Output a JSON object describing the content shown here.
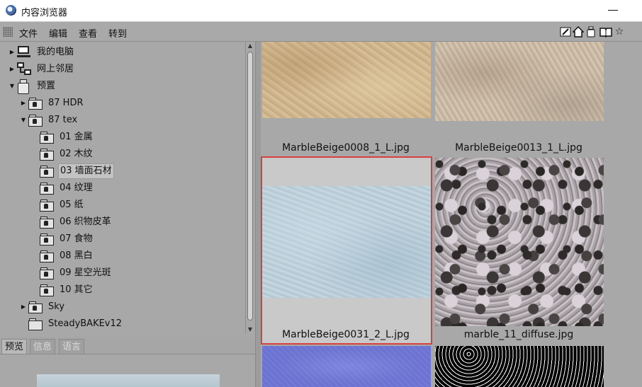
{
  "window": {
    "title": "内容浏览器"
  },
  "menu": {
    "items": [
      "文件",
      "编辑",
      "查看",
      "转到"
    ]
  },
  "toolbar": {
    "icons": [
      "edit-icon",
      "home-icon",
      "gallery-icon",
      "book-icon",
      "favorite-icon"
    ]
  },
  "tree": {
    "items": [
      {
        "label": "我的电脑",
        "icon": "computer-icon",
        "expander": "▶"
      },
      {
        "label": "网上邻居",
        "icon": "network-icon",
        "expander": "▶"
      },
      {
        "label": "预置",
        "icon": "presets-icon",
        "expander": "▼"
      },
      {
        "label": "87 HDR",
        "icon": "locked-folder-icon",
        "expander": "▶"
      },
      {
        "label": "87 tex",
        "icon": "locked-folder-open-icon",
        "expander": "▼"
      },
      {
        "label": "01 金属",
        "icon": "locked-folder-icon"
      },
      {
        "label": "02 木纹",
        "icon": "locked-folder-icon"
      },
      {
        "label": "03 墙面石材",
        "icon": "locked-folder-icon",
        "selected": true
      },
      {
        "label": "04 纹理",
        "icon": "locked-folder-icon"
      },
      {
        "label": "05 纸",
        "icon": "locked-folder-icon"
      },
      {
        "label": "06 织物皮革",
        "icon": "locked-folder-icon"
      },
      {
        "label": "07 食物",
        "icon": "locked-folder-icon"
      },
      {
        "label": "08 黑白",
        "icon": "locked-folder-icon"
      },
      {
        "label": "09 星空光斑",
        "icon": "locked-folder-icon"
      },
      {
        "label": "10 其它",
        "icon": "locked-folder-icon"
      },
      {
        "label": "Sky",
        "icon": "locked-folder-icon",
        "expander": "▶"
      },
      {
        "label": "SteadyBAKEv12",
        "icon": "folder-icon"
      }
    ]
  },
  "bottom_tabs": {
    "items": [
      "预览",
      "信息",
      "语言"
    ],
    "active": "预览"
  },
  "grid": {
    "items": [
      {
        "caption": "MarbleBeige0008_1_L.jpg",
        "texture": "beige-marble",
        "selected": false
      },
      {
        "caption": "MarbleBeige0013_1_L.jpg",
        "texture": "beige-marble",
        "selected": false
      },
      {
        "caption": "MarbleBeige0031_2_L.jpg",
        "texture": "pale-blue-marble",
        "selected": true
      },
      {
        "caption": "marble_11_diffuse.jpg",
        "texture": "granite",
        "selected": false
      },
      {
        "caption": "",
        "texture": "purple-texture",
        "selected": false
      },
      {
        "caption": "",
        "texture": "black-white-noise",
        "selected": false
      }
    ]
  },
  "colors": {
    "selection_border": "#d94040",
    "panel_bg": "#a8a8a8"
  }
}
